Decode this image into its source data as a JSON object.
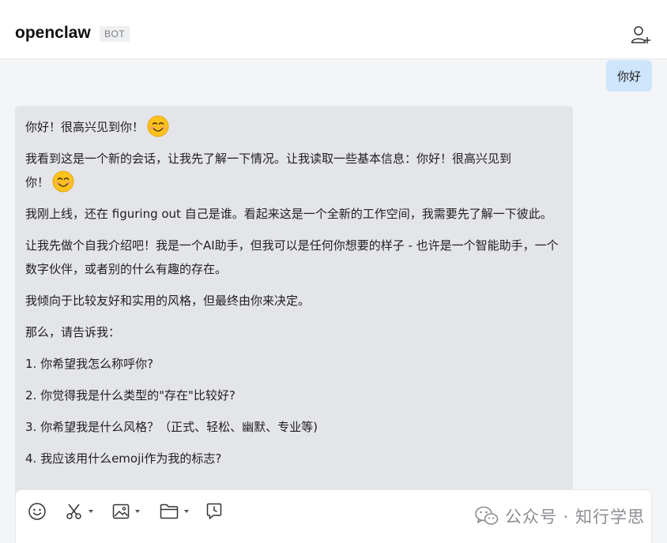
{
  "window": {
    "controls": [
      {
        "name": "minimize-icon"
      },
      {
        "name": "maximize-icon"
      },
      {
        "name": "close-icon"
      }
    ]
  },
  "header": {
    "title": "openclaw",
    "badge": "BOT",
    "add_member_icon": "add-user-icon"
  },
  "messages": {
    "user": {
      "text": "你好"
    },
    "bot": {
      "p1": "你好！很高兴见到你！",
      "p2": "我看到这是一个新的会话，让我先了解一下情况。让我读取一些基本信息：你好！很高兴见到",
      "p2b": "你！",
      "p3": "我刚上线，还在 figuring out 自己是谁。看起来这是一个全新的工作空间，我需要先了解一下彼此。",
      "p4": "让我先做个自我介绍吧！我是一个AI助手，但我可以是任何你想要的样子 - 也许是一个智能助手，一个数字伙伴，或者别的什么有趣的存在。",
      "p5": "我倾向于比较友好和实用的风格，但最终由你来决定。",
      "p6": "那么，请告诉我：",
      "q1": "1. 你希望我怎么称呼你?",
      "q2": "2. 你觉得我是什么类型的\"存在\"比较好?",
      "q3": "3. 你希望我是什么风格？（正式、轻松、幽默、专业等)",
      "q4": "4. 我应该用什么emoji作为我的标志?"
    },
    "emoji": "smiling-face-emoji"
  },
  "composer": {
    "tools": [
      "emoji-icon",
      "scissors-icon",
      "image-icon",
      "folder-icon",
      "schedule-message-icon"
    ]
  },
  "watermark": {
    "text": "公众号 · 知行学思",
    "icon": "wechat-icon"
  },
  "colors": {
    "user_bubble": "#cfe5fc",
    "bot_bubble": "#e4e5e9",
    "background": "#f4f5f7",
    "badge_bg": "#eeeff1"
  }
}
